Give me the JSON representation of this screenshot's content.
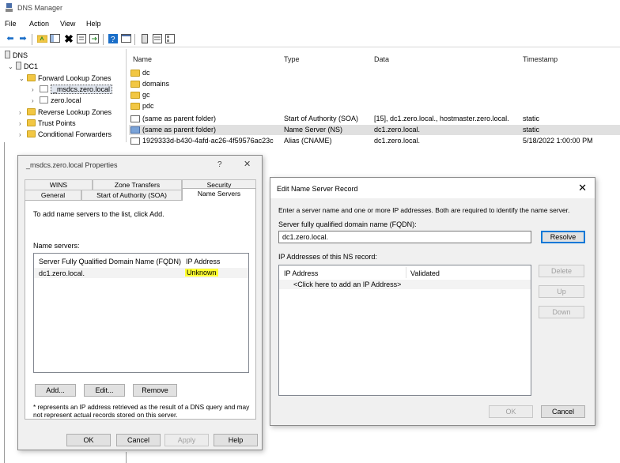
{
  "window": {
    "title": "DNS Manager",
    "menu": [
      "File",
      "Action",
      "View",
      "Help"
    ]
  },
  "tree": {
    "root": "DNS",
    "server": "DC1",
    "forward_zones": "Forward Lookup Zones",
    "zone_msdcs": "_msdcs.zero.local",
    "zone_zero": "zero.local",
    "reverse_zones": "Reverse Lookup Zones",
    "trust_points": "Trust Points",
    "conditional_forwarders": "Conditional Forwarders"
  },
  "list": {
    "columns": [
      "Name",
      "Type",
      "Data",
      "Timestamp"
    ],
    "rows": [
      {
        "name": "dc",
        "type": "",
        "data": "",
        "timestamp": "",
        "icon": "folder"
      },
      {
        "name": "domains",
        "type": "",
        "data": "",
        "timestamp": "",
        "icon": "folder"
      },
      {
        "name": "gc",
        "type": "",
        "data": "",
        "timestamp": "",
        "icon": "folder"
      },
      {
        "name": "pdc",
        "type": "",
        "data": "",
        "timestamp": "",
        "icon": "folder"
      },
      {
        "name": "(same as parent folder)",
        "type": "Start of Authority (SOA)",
        "data": "[15], dc1.zero.local., hostmaster.zero.local.",
        "timestamp": "static",
        "icon": "record"
      },
      {
        "name": "(same as parent folder)",
        "type": "Name Server (NS)",
        "data": "dc1.zero.local.",
        "timestamp": "static",
        "icon": "record-selected"
      },
      {
        "name": "1929333d-b430-4afd-ac26-4f59576ac23c",
        "type": "Alias (CNAME)",
        "data": "dc1.zero.local.",
        "timestamp": "5/18/2022 1:00:00 PM",
        "icon": "record"
      }
    ]
  },
  "props_dialog": {
    "title": "_msdcs.zero.local Properties",
    "help_glyph": "?",
    "close_glyph": "✕",
    "tabs_row1": [
      "WINS",
      "Zone Transfers",
      "Security"
    ],
    "tabs_row2": [
      "General",
      "Start of Authority (SOA)",
      "Name Servers"
    ],
    "active_tab": "Name Servers",
    "instruction": "To add name servers to the list, click Add.",
    "name_servers_label": "Name servers:",
    "columns": [
      "Server Fully Qualified Domain Name (FQDN)",
      "IP Address"
    ],
    "rows": [
      {
        "fqdn": "dc1.zero.local.",
        "ip": "Unknown"
      }
    ],
    "buttons": {
      "add": "Add...",
      "edit": "Edit...",
      "remove": "Remove"
    },
    "footnote_line1": "* represents an IP address retrieved as the result of a DNS query and may",
    "footnote_line2": "not represent actual records stored on this server.",
    "footer": {
      "ok": "OK",
      "cancel": "Cancel",
      "apply": "Apply",
      "help": "Help"
    }
  },
  "ns_dialog": {
    "title": "Edit Name Server Record",
    "close_glyph": "✕",
    "intro": "Enter a server name and one or more IP addresses.  Both are required to identify the name server.",
    "fqdn_label": "Server fully qualified domain name (FQDN):",
    "fqdn_value": "dc1.zero.local.",
    "resolve": "Resolve",
    "ip_label": "IP Addresses of this NS record:",
    "columns": [
      "IP Address",
      "Validated"
    ],
    "placeholder_row": "<Click here to add an IP Address>",
    "side_buttons": {
      "delete": "Delete",
      "up": "Up",
      "down": "Down"
    },
    "ok": "OK",
    "cancel": "Cancel"
  },
  "colors": {
    "highlight": "#ffff30",
    "accent": "#0078d7",
    "folder": "#f2c744"
  }
}
